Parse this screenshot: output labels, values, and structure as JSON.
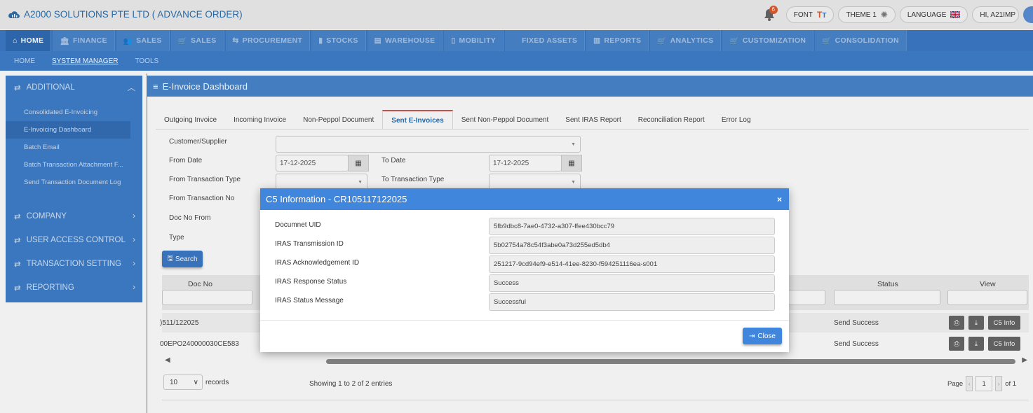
{
  "app": {
    "title": "A2000 SOLUTIONS PTE LTD ( ADVANCE ORDER)",
    "notification_count": "6",
    "font_label": "FONT",
    "theme_label": "THEME 1",
    "language_label": "LANGUAGE",
    "user_label": "HI, A21IMP"
  },
  "main_menu": [
    {
      "label": "HOME",
      "icon": "home-icon"
    },
    {
      "label": "FINANCE",
      "icon": "bank-icon"
    },
    {
      "label": "SALES",
      "icon": "users-icon"
    },
    {
      "label": "SALES",
      "icon": "cart-icon"
    },
    {
      "label": "PROCUREMENT",
      "icon": "procurement-icon"
    },
    {
      "label": "STOCKS",
      "icon": "bar-chart-icon"
    },
    {
      "label": "WAREHOUSE",
      "icon": "warehouse-icon"
    },
    {
      "label": "MOBILITY",
      "icon": "mobile-icon"
    },
    {
      "label": "FIXED ASSETS",
      "icon": ""
    },
    {
      "label": "REPORTS",
      "icon": "report-icon"
    },
    {
      "label": "ANALYTICS",
      "icon": "cart-icon"
    },
    {
      "label": "CUSTOMIZATION",
      "icon": "cart-icon"
    },
    {
      "label": "CONSOLIDATION",
      "icon": "cart-icon"
    }
  ],
  "sub_menu": [
    "HOME",
    "SYSTEM MANAGER",
    "TOOLS"
  ],
  "sidebar": {
    "additional": "ADDITIONAL",
    "items": [
      "Consolidated E-Invoicing",
      "E-Invoicing Dashboard",
      "Batch Email",
      "Batch Transaction Attachment F...",
      "Send Transaction Document Log"
    ],
    "company": "COMPANY",
    "user_access": "USER ACCESS CONTROL",
    "transaction_setting": "TRANSACTION SETTING",
    "reporting": "REPORTING"
  },
  "panel": {
    "title": "E-Invoice Dashboard"
  },
  "tabs": [
    "Outgoing Invoice",
    "Incoming Invoice",
    "Non-Peppol Document",
    "Sent E-Invoices",
    "Sent Non-Peppol Document",
    "Sent IRAS Report",
    "Reconciliation Report",
    "Error Log"
  ],
  "form": {
    "customer_supplier": "Customer/Supplier",
    "from_date": "From Date",
    "from_date_value": "17-12-2025",
    "to_date": "To Date",
    "to_date_value": "17-12-2025",
    "from_txn_type": "From Transaction Type",
    "to_txn_type": "To Transaction Type",
    "from_txn_no": "From Transaction No",
    "doc_no_from": "Doc No From",
    "type": "Type",
    "search": "Search"
  },
  "table": {
    "headers": {
      "doc_no": "Doc No",
      "status": "Status",
      "view": "View"
    },
    "rows": [
      {
        "doc_no": ")511/122025",
        "status": "Send Success",
        "info": "C5 Info"
      },
      {
        "doc_no": "00EPO240000030CE583",
        "status": "Send Success",
        "info": "C5 Info"
      }
    ],
    "records_value": "10",
    "records_label": "records",
    "showing": "Showing 1 to 2 of 2 entries",
    "page_label": "Page",
    "page_value": "1",
    "of_label": "of 1"
  },
  "modal": {
    "title": "C5 Information - CR105117122025",
    "fields": [
      {
        "label": "Documnet UID",
        "value": "5fb9dbc8-7ae0-4732-a307-ffee430bcc79"
      },
      {
        "label": "IRAS Transmission ID",
        "value": "5b02754a78c54f3abe0a73d255ed5db4"
      },
      {
        "label": "IRAS Acknowledgement ID",
        "value": "251217-9cd94ef9-e514-41ee-8230-f594251116ea-s001"
      },
      {
        "label": "IRAS Response Status",
        "value": "Success"
      },
      {
        "label": "IRAS Status Message",
        "value": "Successful"
      }
    ],
    "close": "Close",
    "close_x": "×"
  },
  "colors": {
    "primary": "#3b7ac6",
    "modal_header": "#3f86dc",
    "brand_text": "#2a6fb0",
    "active_tab_border": "#d9534f"
  }
}
